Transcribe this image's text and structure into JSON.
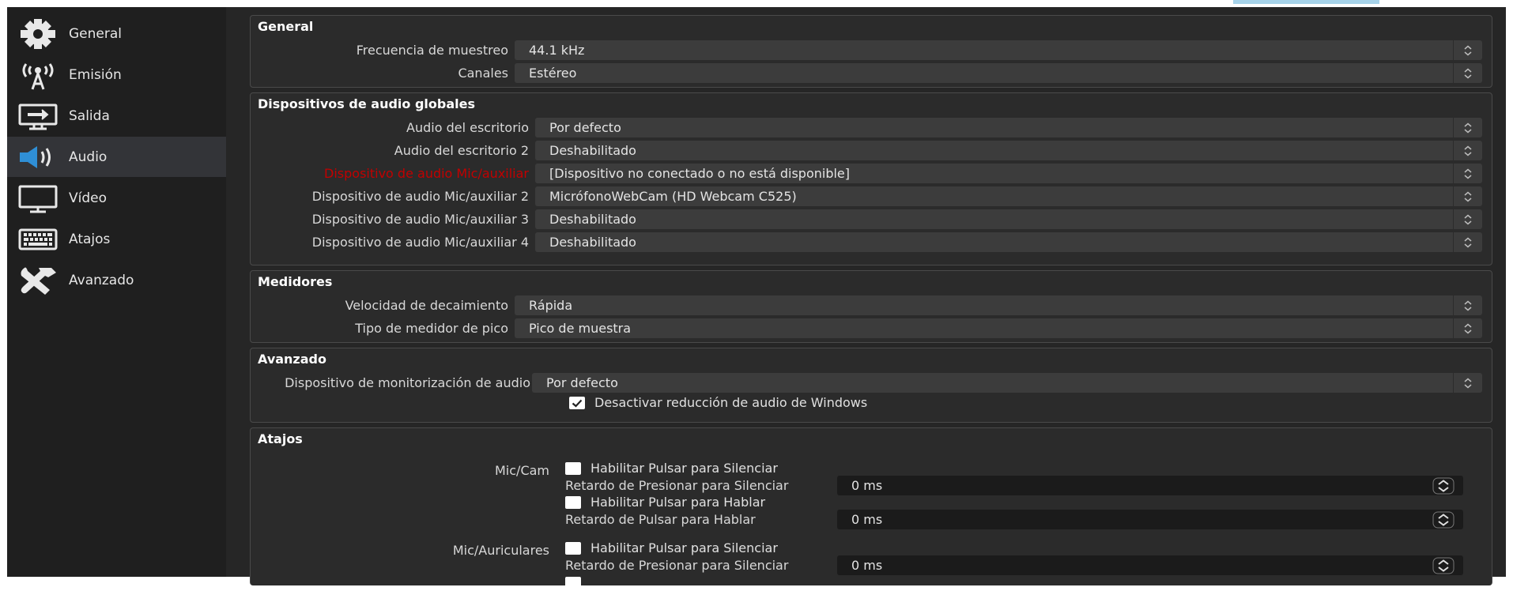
{
  "sidebar": {
    "items": [
      {
        "label": "General",
        "icon": "gear-icon"
      },
      {
        "label": "Emisión",
        "icon": "broadcast-antenna-icon"
      },
      {
        "label": "Salida",
        "icon": "output-monitor-icon"
      },
      {
        "label": "Audio",
        "icon": "speaker-icon",
        "active": true
      },
      {
        "label": "Vídeo",
        "icon": "video-monitor-icon"
      },
      {
        "label": "Atajos",
        "icon": "keyboard-icon"
      },
      {
        "label": "Avanzado",
        "icon": "tools-icon"
      }
    ]
  },
  "general": {
    "title": "General",
    "sample_rate_label": "Frecuencia de muestreo",
    "sample_rate_value": "44.1 kHz",
    "channels_label": "Canales",
    "channels_value": "Estéreo"
  },
  "global_audio": {
    "title": "Dispositivos de audio globales",
    "rows": [
      {
        "label": "Audio del escritorio",
        "value": "Por defecto",
        "error": false
      },
      {
        "label": "Audio del escritorio 2",
        "value": "Deshabilitado",
        "error": false
      },
      {
        "label": "Dispositivo de audio Mic/auxiliar",
        "value": "[Dispositivo no conectado o no está disponible]",
        "error": true
      },
      {
        "label": "Dispositivo de audio Mic/auxiliar 2",
        "value": "MicrófonoWebCam (HD Webcam C525)",
        "error": false
      },
      {
        "label": "Dispositivo de audio Mic/auxiliar 3",
        "value": "Deshabilitado",
        "error": false
      },
      {
        "label": "Dispositivo de audio Mic/auxiliar 4",
        "value": "Deshabilitado",
        "error": false
      }
    ]
  },
  "meters": {
    "title": "Medidores",
    "decay_label": "Velocidad de decaimiento",
    "decay_value": "Rápida",
    "peak_label": "Tipo de medidor de pico",
    "peak_value": "Pico de muestra"
  },
  "advanced": {
    "title": "Avanzado",
    "monitoring_label": "Dispositivo de monitorización de audio",
    "monitoring_value": "Por defecto",
    "ducking_label": "Desactivar reducción de audio de Windows",
    "ducking_checked": true
  },
  "hotkeys": {
    "title": "Atajos",
    "sources": [
      {
        "name": "Mic/Cam",
        "ptm_label": "Habilitar Pulsar para Silenciar",
        "ptm_delay_label": "Retardo de Presionar para Silenciar",
        "ptm_delay_value": "0 ms",
        "ptt_label": "Habilitar Pulsar para Hablar",
        "ptt_delay_label": "Retardo de Pulsar para Hablar",
        "ptt_delay_value": "0 ms"
      },
      {
        "name": "Mic/Auriculares",
        "ptm_label": "Habilitar Pulsar para Silenciar",
        "ptm_delay_label": "Retardo de Presionar para Silenciar",
        "ptm_delay_value": "0 ms"
      }
    ]
  },
  "colors": {
    "sidebar_bg": "#1f1f1f",
    "content_bg": "#262626",
    "group_bg": "#2b2b2b",
    "combo_bg": "#3c3c3c",
    "error_text": "#c20000",
    "accent": "#a7d3ea"
  }
}
